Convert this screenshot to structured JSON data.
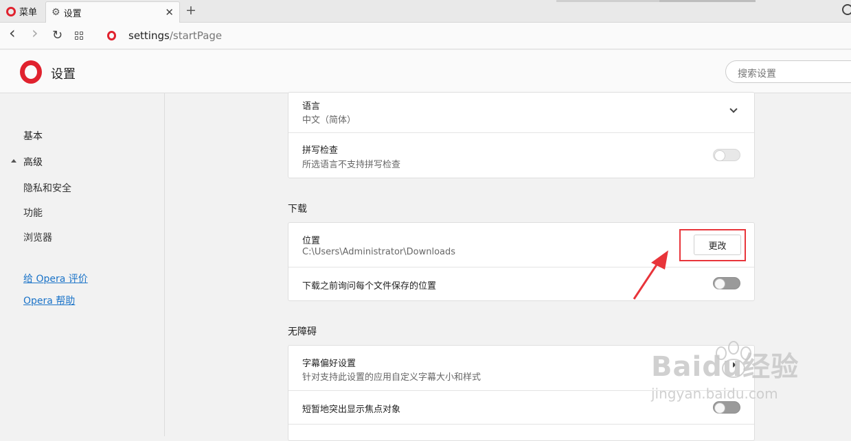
{
  "tabbar": {
    "menu_label": "菜单",
    "active_tab_label": "设置",
    "close_glyph": "✕",
    "add_glyph": "+"
  },
  "addressbar": {
    "url_host": "settings",
    "url_path": "/startPage",
    "back_glyph": "‹",
    "forward_glyph": "›",
    "reload_glyph": "↻"
  },
  "header": {
    "title": "设置",
    "search_placeholder": "搜索设置"
  },
  "sidebar": {
    "items": [
      {
        "label": "基本"
      },
      {
        "label": "高级"
      },
      {
        "label": "隐私和安全"
      },
      {
        "label": "功能"
      },
      {
        "label": "浏览器"
      }
    ],
    "links": [
      {
        "label": "给 Opera 评价"
      },
      {
        "label": "Opera 帮助"
      }
    ]
  },
  "main": {
    "language_card": {
      "language_title": "语言",
      "language_value": "中文（简体）",
      "spellcheck_title": "拼写检查",
      "spellcheck_sub": "所选语言不支持拼写检查",
      "spellcheck_on": false
    },
    "downloads": {
      "section_title": "下载",
      "location_title": "位置",
      "location_value": "C:\\Users\\Administrator\\Downloads",
      "change_button": "更改",
      "ask_title": "下载之前询问每个文件保存的位置",
      "ask_on": false
    },
    "accessibility": {
      "section_title": "无障碍",
      "caption_title": "字幕偏好设置",
      "caption_sub": "针对支持此设置的应用自定义字幕大小和样式",
      "focus_title": "短暂地突出显示焦点对象",
      "focus_on": false
    }
  },
  "watermark": {
    "line1": "Baidu经验",
    "line2": "jingyan.baidu.com"
  },
  "colors": {
    "opera_red": "#e0222e",
    "annotation_red": "#e8343a",
    "link_blue": "#1a73c8"
  }
}
